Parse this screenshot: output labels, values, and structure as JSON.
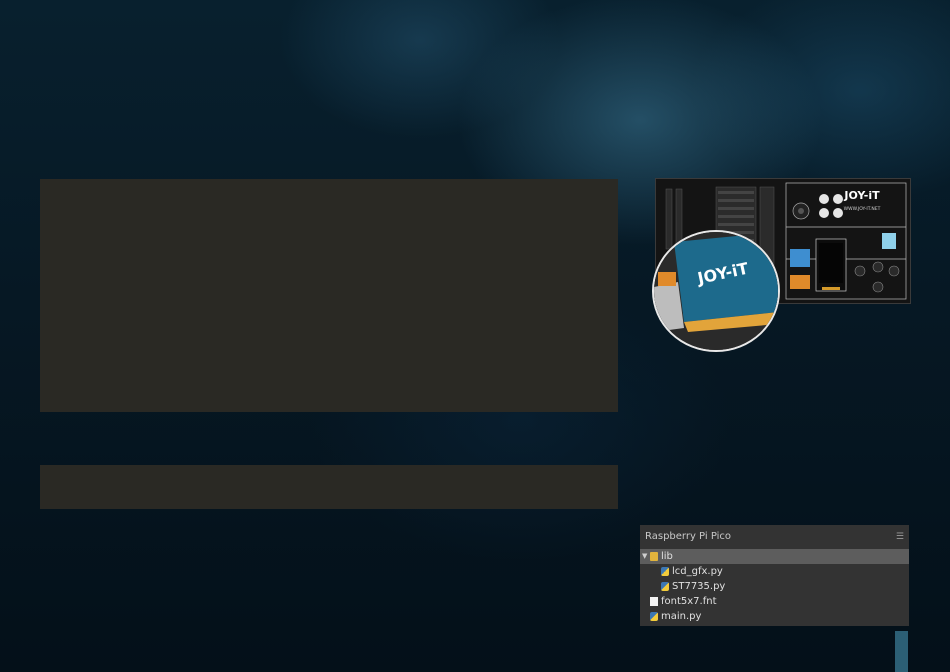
{
  "board": {
    "logo": "JOY-iT",
    "url": "WWW.JOY-IT.NET",
    "inset_logo": "JOY-iT"
  },
  "file_panel": {
    "title": "Raspberry Pi Pico",
    "items": [
      {
        "label": "lib",
        "type": "folder",
        "expanded": true,
        "selected": true
      },
      {
        "label": "lcd_gfx.py",
        "type": "python"
      },
      {
        "label": "ST7735.py",
        "type": "python"
      },
      {
        "label": "font5x7.fnt",
        "type": "file"
      },
      {
        "label": "main.py",
        "type": "python"
      }
    ]
  },
  "icons": {
    "expand": "triangle-down-icon",
    "menu": "hamburger-menu-icon"
  },
  "colors": {
    "editor_bg": "#2a2924",
    "panel_bg": "#333333",
    "selected_row": "#5d5d5d",
    "scroll_thumb": "#2c5f75"
  }
}
